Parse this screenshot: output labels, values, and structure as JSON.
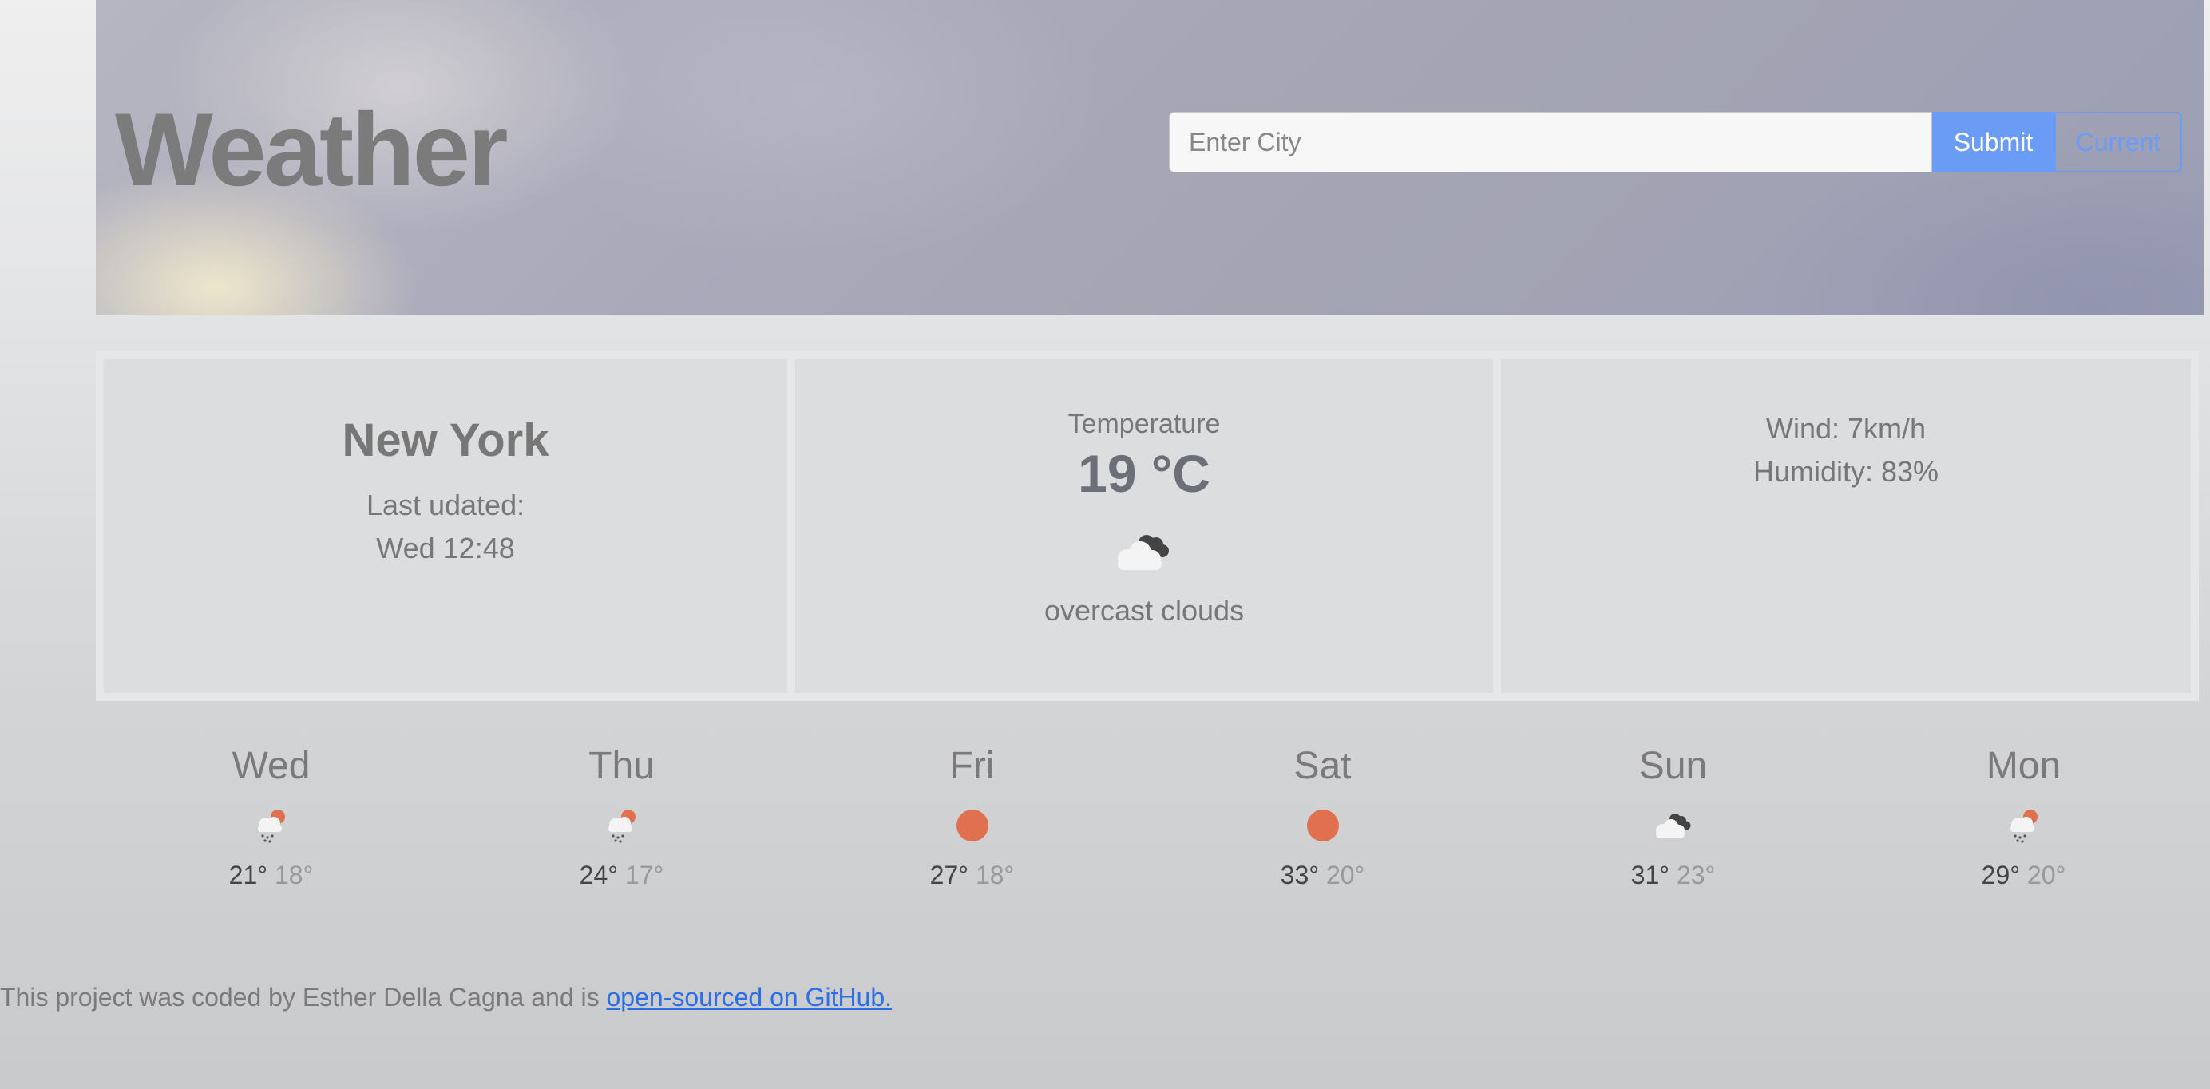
{
  "header": {
    "title": "Weather",
    "search_placeholder": "Enter City",
    "submit_label": "Submit",
    "current_label": "Current"
  },
  "current": {
    "city": "New York",
    "updated_label": "Last udated:",
    "updated_time": "Wed 12:48",
    "temperature_label": "Temperature",
    "temperature": "19 °C",
    "icon": "overcast-clouds-icon",
    "description": "overcast clouds",
    "wind": "Wind: 7km/h",
    "humidity": "Humidity: 83%"
  },
  "forecast": [
    {
      "day": "Wed",
      "icon": "rain-sun-icon",
      "max": "21°",
      "min": "18°"
    },
    {
      "day": "Thu",
      "icon": "rain-sun-icon",
      "max": "24°",
      "min": "17°"
    },
    {
      "day": "Fri",
      "icon": "sun-icon",
      "max": "27°",
      "min": "18°"
    },
    {
      "day": "Sat",
      "icon": "sun-icon",
      "max": "33°",
      "min": "20°"
    },
    {
      "day": "Sun",
      "icon": "overcast-clouds-icon",
      "max": "31°",
      "min": "23°"
    },
    {
      "day": "Mon",
      "icon": "rain-sun-icon",
      "max": "29°",
      "min": "20°"
    }
  ],
  "footer": {
    "text": "This project was coded by Esther Della Cagna and is ",
    "link_text": "open-sourced on GitHub."
  },
  "colors": {
    "accent": "#6b9cf5",
    "sun": "#e07050",
    "link": "#2a6ee8"
  }
}
